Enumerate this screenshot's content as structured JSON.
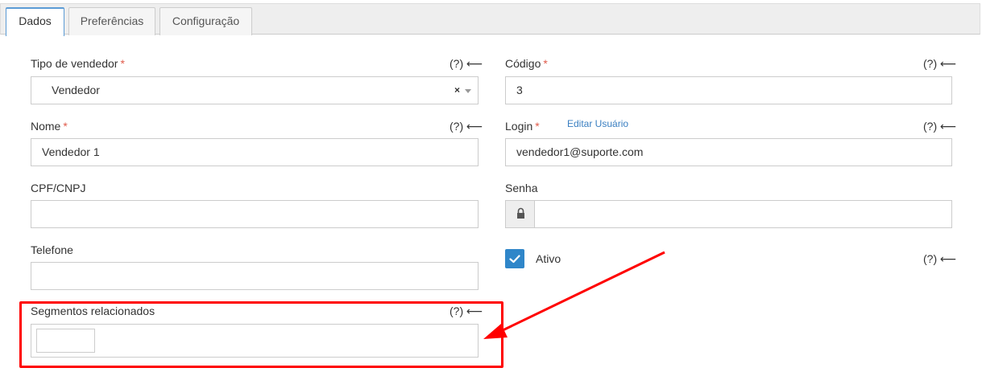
{
  "tabs": [
    {
      "label": "Dados",
      "active": true
    },
    {
      "label": "Preferências",
      "active": false
    },
    {
      "label": "Configuração",
      "active": false
    }
  ],
  "help_text": "(?) ⟵",
  "required_mark": "*",
  "fields": {
    "tipo_vendedor": {
      "label": "Tipo de vendedor",
      "value": "Vendedor",
      "clear": "×"
    },
    "codigo": {
      "label": "Código",
      "value": "3"
    },
    "nome": {
      "label": "Nome",
      "value": "Vendedor 1"
    },
    "login": {
      "label": "Login",
      "value": "vendedor1@suporte.com",
      "link": "Editar Usuário"
    },
    "cpf_cnpj": {
      "label": "CPF/CNPJ",
      "value": ""
    },
    "senha": {
      "label": "Senha",
      "value": ""
    },
    "telefone": {
      "label": "Telefone",
      "value": ""
    },
    "ativo": {
      "label": "Ativo",
      "checked": true
    },
    "segmentos": {
      "label": "Segmentos relacionados",
      "value": ""
    }
  },
  "colors": {
    "accent": "#2f86c9",
    "required": "#e05b4b",
    "annotation": "#ff0000",
    "link": "#3a7fc1"
  }
}
